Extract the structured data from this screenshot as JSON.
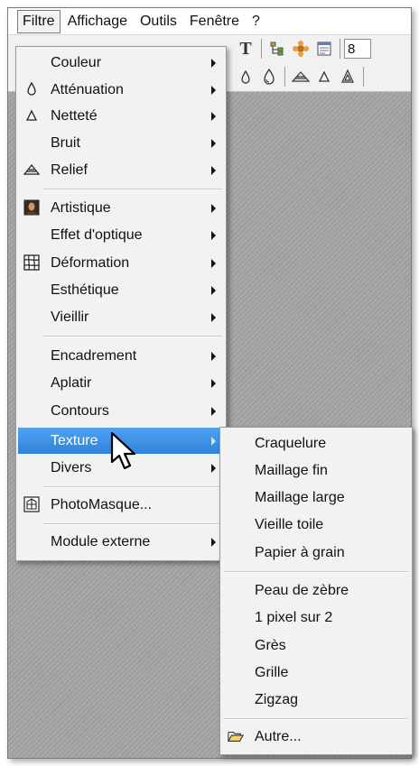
{
  "menubar": {
    "items": [
      "Filtre",
      "Affichage",
      "Outils",
      "Fenêtre",
      "?"
    ]
  },
  "toolbar": {
    "text_tool": "T",
    "zoom_value": "8"
  },
  "filter_menu": {
    "items": [
      {
        "label": "Couleur",
        "icon": "",
        "submenu": true
      },
      {
        "label": "Atténuation",
        "icon": "drop-icon",
        "submenu": true
      },
      {
        "label": "Netteté",
        "icon": "triangle-icon",
        "submenu": true
      },
      {
        "label": "Bruit",
        "icon": "",
        "submenu": true
      },
      {
        "label": "Relief",
        "icon": "relief-icon",
        "submenu": true
      },
      {
        "label": "Artistique",
        "icon": "portrait-icon",
        "submenu": true
      },
      {
        "label": "Effet d'optique",
        "icon": "",
        "submenu": true
      },
      {
        "label": "Déformation",
        "icon": "grid-distort-icon",
        "submenu": true
      },
      {
        "label": "Esthétique",
        "icon": "",
        "submenu": true
      },
      {
        "label": "Vieillir",
        "icon": "",
        "submenu": true
      },
      {
        "label": "Encadrement",
        "icon": "",
        "submenu": true
      },
      {
        "label": "Aplatir",
        "icon": "",
        "submenu": true
      },
      {
        "label": "Contours",
        "icon": "",
        "submenu": true
      },
      {
        "label": "Texture",
        "icon": "",
        "submenu": true,
        "highlighted": true
      },
      {
        "label": "Divers",
        "icon": "",
        "submenu": true
      },
      {
        "label": "PhotoMasque...",
        "icon": "photomask-icon",
        "submenu": false
      },
      {
        "label": "Module externe",
        "icon": "",
        "submenu": true
      }
    ]
  },
  "texture_submenu": {
    "items": [
      {
        "label": "Craquelure"
      },
      {
        "label": "Maillage fin"
      },
      {
        "label": "Maillage large"
      },
      {
        "label": "Vieille toile"
      },
      {
        "label": "Papier à grain"
      },
      {
        "label": "Peau de zèbre"
      },
      {
        "label": "1 pixel sur 2"
      },
      {
        "label": "Grès"
      },
      {
        "label": "Grille"
      },
      {
        "label": "Zigzag"
      },
      {
        "label": "Autre...",
        "icon": "folder-open-icon"
      }
    ]
  },
  "colors": {
    "highlight": "#3a8ee6",
    "menu_bg": "#f2f2f2",
    "canvas_bg": "#a4a4a4"
  }
}
